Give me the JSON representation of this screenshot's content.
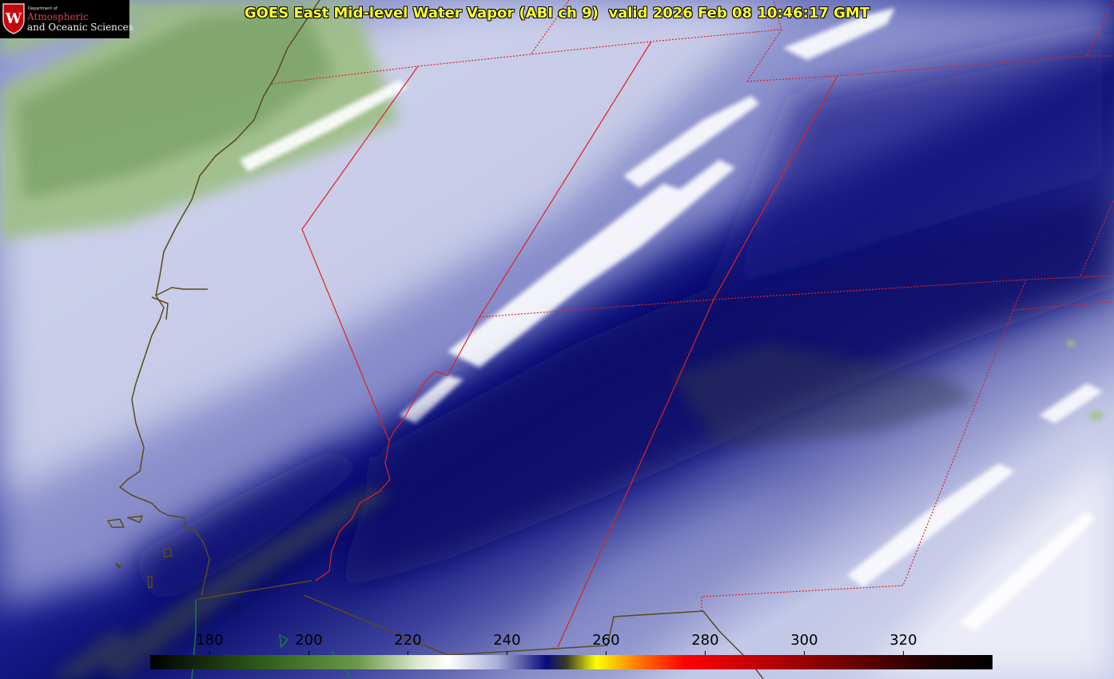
{
  "title": "GOES East Mid-level Water Vapor (ABI ch 9)  valid 2026 Feb 08 10:46:17 GMT",
  "logo": {
    "department": "Department of",
    "line1": "Atmospheric",
    "line2": "and Oceanic Sciences",
    "crest_letter": "W",
    "icon": "university-crest-icon"
  },
  "colorbar": {
    "range": [
      168,
      338
    ],
    "ticks": [
      {
        "value": 180,
        "label": "180"
      },
      {
        "value": 200,
        "label": "200"
      },
      {
        "value": 220,
        "label": "220"
      },
      {
        "value": 240,
        "label": "240"
      },
      {
        "value": 260,
        "label": "260"
      },
      {
        "value": 280,
        "label": "280"
      },
      {
        "value": 300,
        "label": "300"
      },
      {
        "value": 320,
        "label": "320"
      }
    ],
    "stops": [
      {
        "value": 168,
        "color": "#000000"
      },
      {
        "value": 190,
        "color": "#2e5a1a"
      },
      {
        "value": 210,
        "color": "#6a9a4a"
      },
      {
        "value": 222,
        "color": "#dde8d0"
      },
      {
        "value": 228,
        "color": "#ffffff"
      },
      {
        "value": 238,
        "color": "#aab0d8"
      },
      {
        "value": 248,
        "color": "#0a0a7a"
      },
      {
        "value": 252,
        "color": "#3a3a2a"
      },
      {
        "value": 258,
        "color": "#ffff00"
      },
      {
        "value": 266,
        "color": "#ff8000"
      },
      {
        "value": 276,
        "color": "#ff0000"
      },
      {
        "value": 300,
        "color": "#990000"
      },
      {
        "value": 325,
        "color": "#200000"
      },
      {
        "value": 338,
        "color": "#000000"
      }
    ]
  },
  "colors": {
    "title": "#ffff33",
    "borders": "#dd2222",
    "coastline": "#5a4a1a",
    "tick_label": "#000000"
  }
}
